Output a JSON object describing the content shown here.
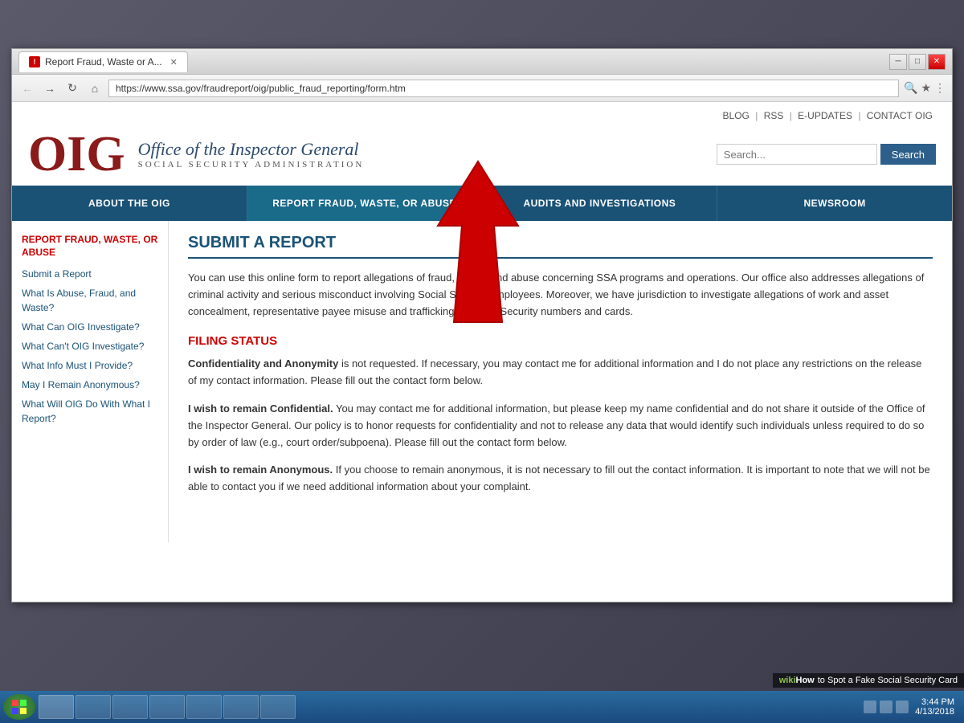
{
  "browser": {
    "tab_title": "Report Fraud, Waste or A...",
    "url": "https://www.ssa.gov/fraudreport/oig/public_fraud_reporting/form.htm",
    "window_controls": {
      "minimize": "─",
      "maximize": "□",
      "close": "✕"
    }
  },
  "top_links": {
    "blog": "BLOG",
    "rss": "RSS",
    "eupdates": "E-UPDATES",
    "contact": "CONTACT OIG"
  },
  "header": {
    "logo_text": "OIG",
    "main_title": "Office of the Inspector General",
    "sub_title": "SOCIAL SECURITY ADMINISTRATION",
    "search_placeholder": "Search...",
    "search_button": "Search"
  },
  "nav": {
    "items": [
      {
        "label": "ABOUT THE OIG",
        "active": false
      },
      {
        "label": "REPORT FRAUD, WASTE, OR ABUSE",
        "active": true
      },
      {
        "label": "AUDITS AND INVESTIGATIONS",
        "active": false
      },
      {
        "label": "NEWSROOM",
        "active": false
      }
    ]
  },
  "sidebar": {
    "heading": "REPORT FRAUD, WASTE, OR ABUSE",
    "links": [
      "Submit a Report",
      "What Is Abuse, Fraud, and Waste?",
      "What Can OIG Investigate?",
      "What Can't OIG Investigate?",
      "What Info Must I Provide?",
      "May I Remain Anonymous?",
      "What Will OIG Do With What I Report?"
    ]
  },
  "main": {
    "page_title": "SUBMIT A REPORT",
    "intro": "You can use this online form to report allegations of fraud, waste, and abuse concerning SSA programs and operations. Our office also addresses allegations of criminal activity and serious misconduct involving Social Security employees. Moreover, we have jurisdiction to investigate allegations of work and asset concealment, representative payee misuse and trafficking of Social Security numbers and cards.",
    "filing_status_heading": "FILING STATUS",
    "para1_label": "Confidentiality and Anonymity",
    "para1_text": " is not requested. If necessary, you may contact me for additional information and I do not place any restrictions on the release of my contact information. Please fill out the contact form below.",
    "para2_label": "I wish to remain Confidential.",
    "para2_text": " You may contact me for additional information, but please keep my name confidential and do not share it outside of the Office of the Inspector General. Our policy is to honor requests for confidentiality and not to release any data that would identify such individuals unless required to do so by order of law (e.g., court order/subpoena). Please fill out the contact form below.",
    "para3_label": "I wish to remain Anonymous.",
    "para3_text": " If you choose to remain anonymous, it is not necessary to fill out the contact information. It is important to note that we will not be able to contact you if we need additional information about your complaint."
  },
  "taskbar": {
    "time": "3:44 PM",
    "date": "4/13/2018"
  },
  "wikihow": {
    "prefix": "wiki",
    "how": "How",
    "suffix": "to Spot a Fake Social Security Card"
  }
}
